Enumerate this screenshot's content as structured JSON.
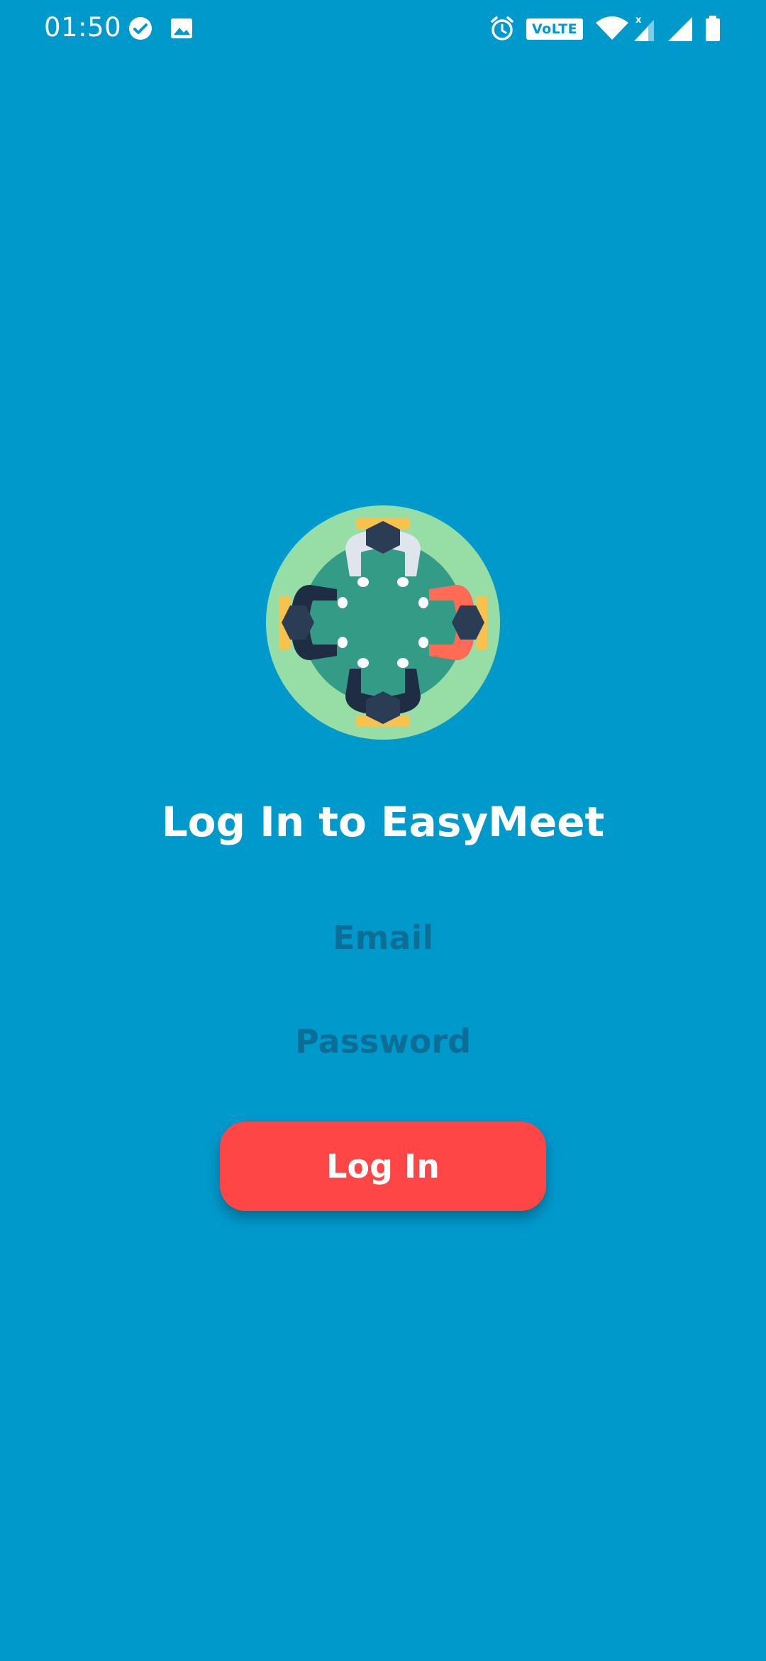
{
  "status_bar": {
    "time": "01:50",
    "icons": [
      "check-circle-icon",
      "image-icon",
      "alarm-icon",
      "volte-icon",
      "wifi-icon",
      "signal-icon",
      "signal-icon",
      "battery-icon"
    ],
    "volte_label": "VoLTE 1"
  },
  "logo": {
    "icon": "meeting-table-icon",
    "colors": {
      "outer_ring": "#97dea6",
      "table": "#339b86",
      "person_dark": "#2b3d55",
      "person_light": "#e0e4ec",
      "person_red": "#ff6b54",
      "chair": "#f7c24e"
    }
  },
  "login": {
    "title": "Log In to EasyMeet",
    "email_placeholder": "Email",
    "password_placeholder": "Password",
    "submit_label": "Log In"
  },
  "theme": {
    "background": "#0099cc",
    "button": "#ff4646",
    "placeholder": "#0a6e96"
  }
}
